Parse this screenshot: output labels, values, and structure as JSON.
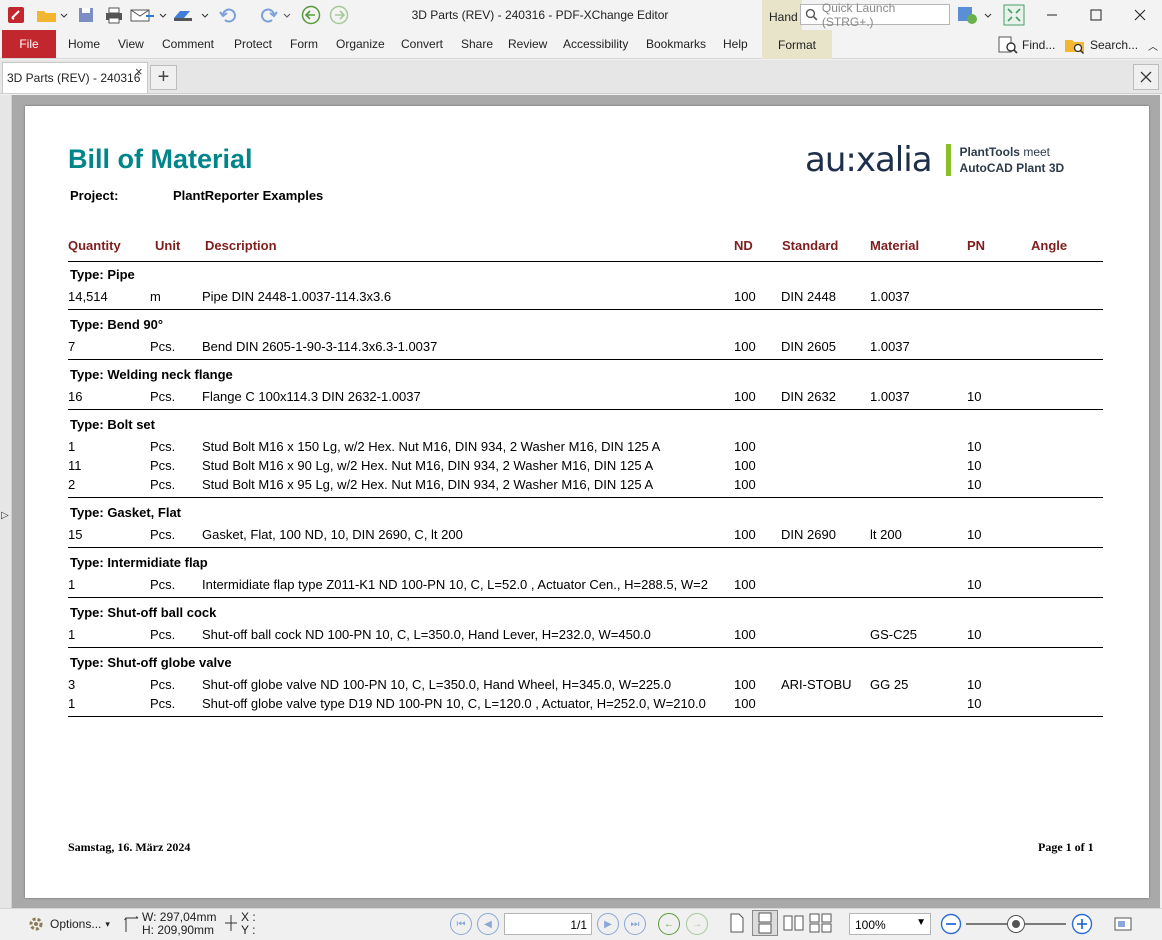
{
  "window": {
    "title": "3D Parts (REV) - 240316 - PDF-XChange Editor",
    "hand_tab": "Hand",
    "quick_launch_placeholder": "Quick Launch (STRG+.)"
  },
  "ribbon": {
    "file": "File",
    "tabs": [
      "Home",
      "View",
      "Comment",
      "Protect",
      "Form",
      "Organize",
      "Convert",
      "Share",
      "Review",
      "Accessibility",
      "Bookmarks",
      "Help"
    ],
    "format": "Format",
    "find": "Find...",
    "search": "Search..."
  },
  "document_tab": {
    "label": "3D Parts (REV) - 240316",
    "close": "×",
    "new": "+"
  },
  "document": {
    "title": "Bill of Material",
    "project_label": "Project:",
    "project_value": "PlantReporter Examples",
    "logo": {
      "brand": "au:xalia",
      "line1_bold": "PlantTools",
      "line1_thin": " meet",
      "line2": "AutoCAD Plant 3D",
      "accent": "#8bbf2a"
    },
    "columns": [
      "Quantity",
      "Unit",
      "Description",
      "ND",
      "Standard",
      "Material",
      "PN",
      "Angle"
    ],
    "groups": [
      {
        "type": "Type: Pipe",
        "rows": [
          {
            "qty": "14,514",
            "unit": "m",
            "desc": "Pipe DIN 2448-1.0037-114.3x3.6",
            "nd": "100",
            "std": "DIN 2448",
            "mat": "1.0037",
            "pn": ""
          }
        ]
      },
      {
        "type": "Type: Bend 90°",
        "rows": [
          {
            "qty": "7",
            "unit": "Pcs.",
            "desc": "Bend DIN 2605-1-90-3-114.3x6.3-1.0037",
            "nd": "100",
            "std": "DIN 2605",
            "mat": "1.0037",
            "pn": ""
          }
        ]
      },
      {
        "type": "Type: Welding neck flange",
        "rows": [
          {
            "qty": "16",
            "unit": "Pcs.",
            "desc": "Flange C 100x114.3 DIN 2632-1.0037",
            "nd": "100",
            "std": "DIN 2632",
            "mat": "1.0037",
            "pn": "10"
          }
        ]
      },
      {
        "type": "Type: Bolt set",
        "rows": [
          {
            "qty": "1",
            "unit": "Pcs.",
            "desc": "Stud Bolt M16 x 150 Lg,  w/2 Hex. Nut M16, DIN 934, 2 Washer M16, DIN 125 A",
            "nd": "100",
            "std": "",
            "mat": "",
            "pn": "10"
          },
          {
            "qty": "11",
            "unit": "Pcs.",
            "desc": "Stud Bolt M16 x 90 Lg,  w/2 Hex. Nut M16, DIN 934, 2 Washer M16, DIN 125 A",
            "nd": "100",
            "std": "",
            "mat": "",
            "pn": "10"
          },
          {
            "qty": "2",
            "unit": "Pcs.",
            "desc": "Stud Bolt M16 x 95 Lg,  w/2 Hex. Nut M16, DIN 934, 2 Washer M16, DIN 125 A",
            "nd": "100",
            "std": "",
            "mat": "",
            "pn": "10"
          }
        ]
      },
      {
        "type": "Type: Gasket, Flat",
        "rows": [
          {
            "qty": "15",
            "unit": "Pcs.",
            "desc": "Gasket, Flat, 100 ND, 10, DIN 2690, C, lt 200",
            "nd": "100",
            "std": "DIN 2690",
            "mat": "lt 200",
            "pn": "10"
          }
        ]
      },
      {
        "type": "Type: Intermidiate flap",
        "rows": [
          {
            "qty": "1",
            "unit": "Pcs.",
            "desc": "Intermidiate flap type Z011-K1 ND 100-PN 10, C, L=52.0 , Actuator Cen., H=288.5, W=2",
            "nd": "100",
            "std": "",
            "mat": "",
            "pn": "10"
          }
        ]
      },
      {
        "type": "Type: Shut-off ball cock",
        "rows": [
          {
            "qty": "1",
            "unit": "Pcs.",
            "desc": "Shut-off ball cock ND 100-PN 10, C, L=350.0, Hand Lever, H=232.0, W=450.0",
            "nd": "100",
            "std": "",
            "mat": "GS-C25",
            "pn": "10"
          }
        ]
      },
      {
        "type": "Type: Shut-off globe valve",
        "rows": [
          {
            "qty": "3",
            "unit": "Pcs.",
            "desc": "Shut-off globe valve ND 100-PN 10, C, L=350.0, Hand Wheel, H=345.0, W=225.0",
            "nd": "100",
            "std": "ARI-STOBU",
            "mat": "GG 25",
            "pn": "10"
          },
          {
            "qty": "1",
            "unit": "Pcs.",
            "desc": "Shut-off globe valve type D19 ND 100-PN 10, C, L=120.0 , Actuator, H=252.0, W=210.0",
            "nd": "100",
            "std": "",
            "mat": "",
            "pn": "10"
          }
        ]
      }
    ],
    "footer_date": "Samstag, 16. März 2024",
    "footer_page": "Page 1 of 1"
  },
  "statusbar": {
    "options": "Options...",
    "width": "W: 297,04mm",
    "height": "H: 209,90mm",
    "x": "X :",
    "y": "Y :",
    "page": "1/1",
    "zoom": "100%"
  }
}
